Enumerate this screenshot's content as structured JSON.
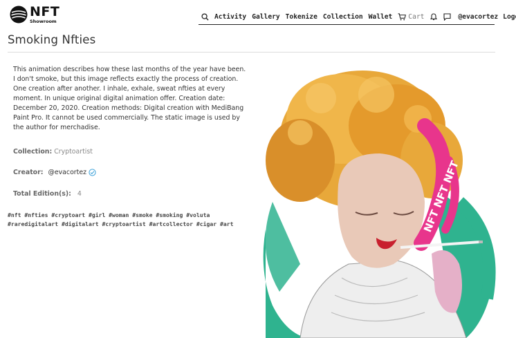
{
  "header": {
    "logo": {
      "title": "NFT",
      "subtitle": "Showroom"
    },
    "nav": {
      "search_icon": "search-icon",
      "items": [
        "Activity",
        "Gallery",
        "Tokenize",
        "Collection",
        "Wallet"
      ],
      "cart_label": "Cart",
      "bell_icon": "bell-icon",
      "chat_icon": "chat-icon",
      "username": "@evacortez",
      "logout": "Logout"
    }
  },
  "page": {
    "title": "Smoking Nfties",
    "description": "This animation describes how these last months of the year have been. I don't smoke, but this image reflects exactly the process of creation. One creation after another. I inhale, exhale, sweat nfties at every moment. In unique original digital animation offer. Creation date: December 20, 2020. Creation methods: Digital creation with MediBang Paint Pro. It cannot be used commercially. The static image is used by the author for merchadise.",
    "collection_label": "Collection:",
    "collection_value": "Cryptoartist",
    "creator_label": "Creator:",
    "creator_value": "@evacortez",
    "editions_label": "Total Edition(s):",
    "editions_value": "4",
    "tags_line1": "#nft #nfties #cryptoart #girl #woman #smoke #smoking #voluta",
    "tags_line2": "#raredigitalart #digitalart #cryptoartist #artcollector #cigar #art"
  },
  "artwork": {
    "caption": "NFT NFT NFT",
    "colors": {
      "hair": "#e8a83a",
      "smoke": "#e8358c",
      "backdrop": "#2fb38f",
      "skin": "#e9c9b8"
    }
  },
  "colors": {
    "verified": "#3aa0d8",
    "divider": "#dddddd"
  }
}
